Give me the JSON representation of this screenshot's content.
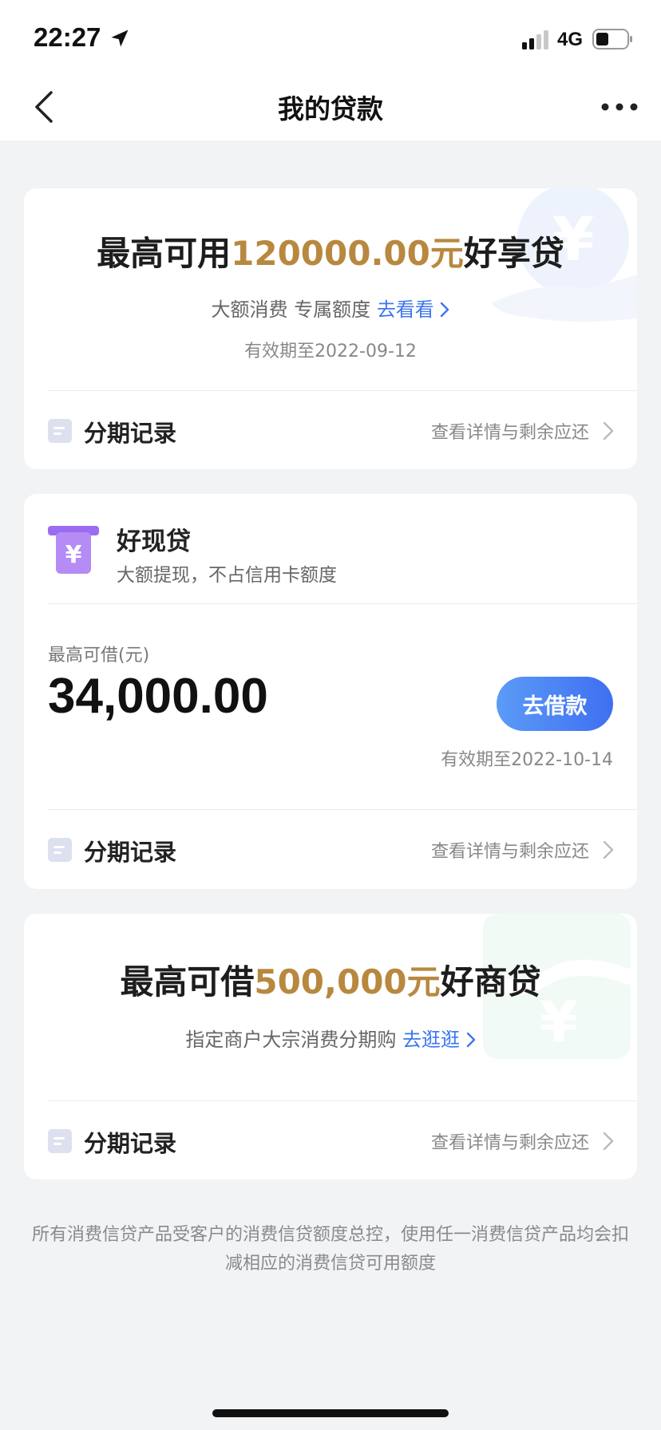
{
  "status_bar": {
    "time": "22:27",
    "network": "4G",
    "icons": [
      "location-arrow-icon",
      "signal-icon",
      "battery-icon"
    ]
  },
  "nav": {
    "title": "我的贷款",
    "back_icon": "chevron-left-icon",
    "more_icon": "more-dots-icon"
  },
  "card_haoxiang": {
    "headline_prefix": "最高可用",
    "headline_amount": "120000.00元",
    "headline_suffix": "好享贷",
    "subtitle": "大额消费 专属额度",
    "link_label": "去看看",
    "validity": "有效期至2022-09-12",
    "record_label": "分期记录",
    "record_link": "查看详情与剩余应还"
  },
  "card_haoxian": {
    "product_name": "好现贷",
    "product_desc": "大额提现，不占信用卡额度",
    "limit_label": "最高可借(元)",
    "limit_amount": "34,000.00",
    "borrow_button": "去借款",
    "validity": "有效期至2022-10-14",
    "record_label": "分期记录",
    "record_link": "查看详情与剩余应还"
  },
  "card_haoshang": {
    "headline_prefix": "最高可借",
    "headline_amount": "500,000元",
    "headline_suffix": "好商贷",
    "subtitle": "指定商户大宗消费分期购",
    "link_label": "去逛逛",
    "record_label": "分期记录",
    "record_link": "查看详情与剩余应还"
  },
  "disclaimer": "所有消费信贷产品受客户的消费信贷额度总控，使用任一消费信贷产品均会扣减相应的消费信贷可用额度",
  "colors": {
    "accent_blue": "#3c76f0",
    "gold": "#b8883f",
    "product_purple": "#9b6cf0",
    "background": "#f2f3f5"
  }
}
